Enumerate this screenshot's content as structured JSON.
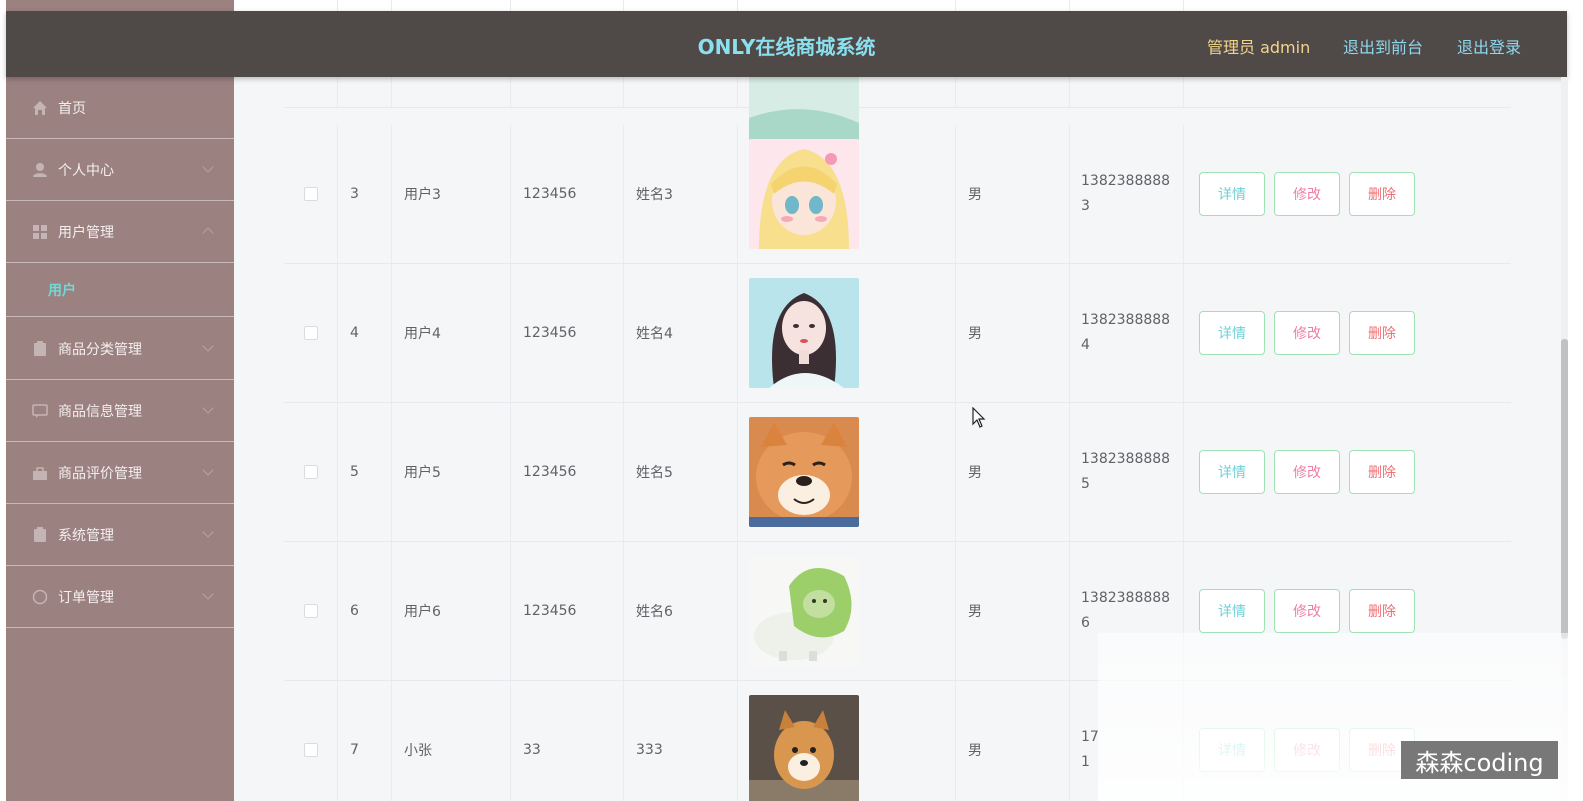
{
  "header": {
    "title": "ONLY在线商城系统",
    "admin_label": "管理员 admin",
    "back_to_front": "退出到前台",
    "logout": "退出登录"
  },
  "sidebar": {
    "items": [
      {
        "label": "首页",
        "icon": "home-icon"
      },
      {
        "label": "个人中心",
        "icon": "user-icon"
      },
      {
        "label": "用户管理",
        "icon": "grid-icon"
      },
      {
        "label": "商品分类管理",
        "icon": "clipboard-icon"
      },
      {
        "label": "商品信息管理",
        "icon": "message-icon"
      },
      {
        "label": "商品评价管理",
        "icon": "bag-icon"
      },
      {
        "label": "系统管理",
        "icon": "clipboard-icon"
      },
      {
        "label": "订单管理",
        "icon": "clock-icon"
      }
    ],
    "submenu_active": "用户"
  },
  "table": {
    "rows": [
      {
        "id": "3",
        "username": "用户3",
        "password": "123456",
        "name": "姓名3",
        "sex": "男",
        "phone": "1382388888\n3",
        "avatar": "anime-blonde-girl"
      },
      {
        "id": "4",
        "username": "用户4",
        "password": "123456",
        "name": "姓名4",
        "sex": "男",
        "phone": "1382388888\n4",
        "avatar": "anime-dark-hair-girl"
      },
      {
        "id": "5",
        "username": "用户5",
        "password": "123456",
        "name": "姓名5",
        "sex": "男",
        "phone": "1382388888\n5",
        "avatar": "shiba-dog-smiling"
      },
      {
        "id": "6",
        "username": "用户6",
        "password": "123456",
        "name": "姓名6",
        "sex": "男",
        "phone": "1382388888\n6",
        "avatar": "cabbage-dog"
      },
      {
        "id": "7",
        "username": "小张",
        "password": "33",
        "name": "333",
        "sex": "男",
        "phone": "17\n1",
        "avatar": "shiba-dog-sitting"
      }
    ],
    "actions": {
      "detail": "详情",
      "edit": "修改",
      "delete": "删除"
    }
  },
  "watermark": "森森coding",
  "colors": {
    "sidebar_bg": "#9c8181",
    "header_bg": "#4f4948",
    "title_color": "#8be0ef",
    "admin_color": "#f2d58c",
    "active_submenu": "#6fd9d6",
    "button_border": "#9fe3b5"
  }
}
